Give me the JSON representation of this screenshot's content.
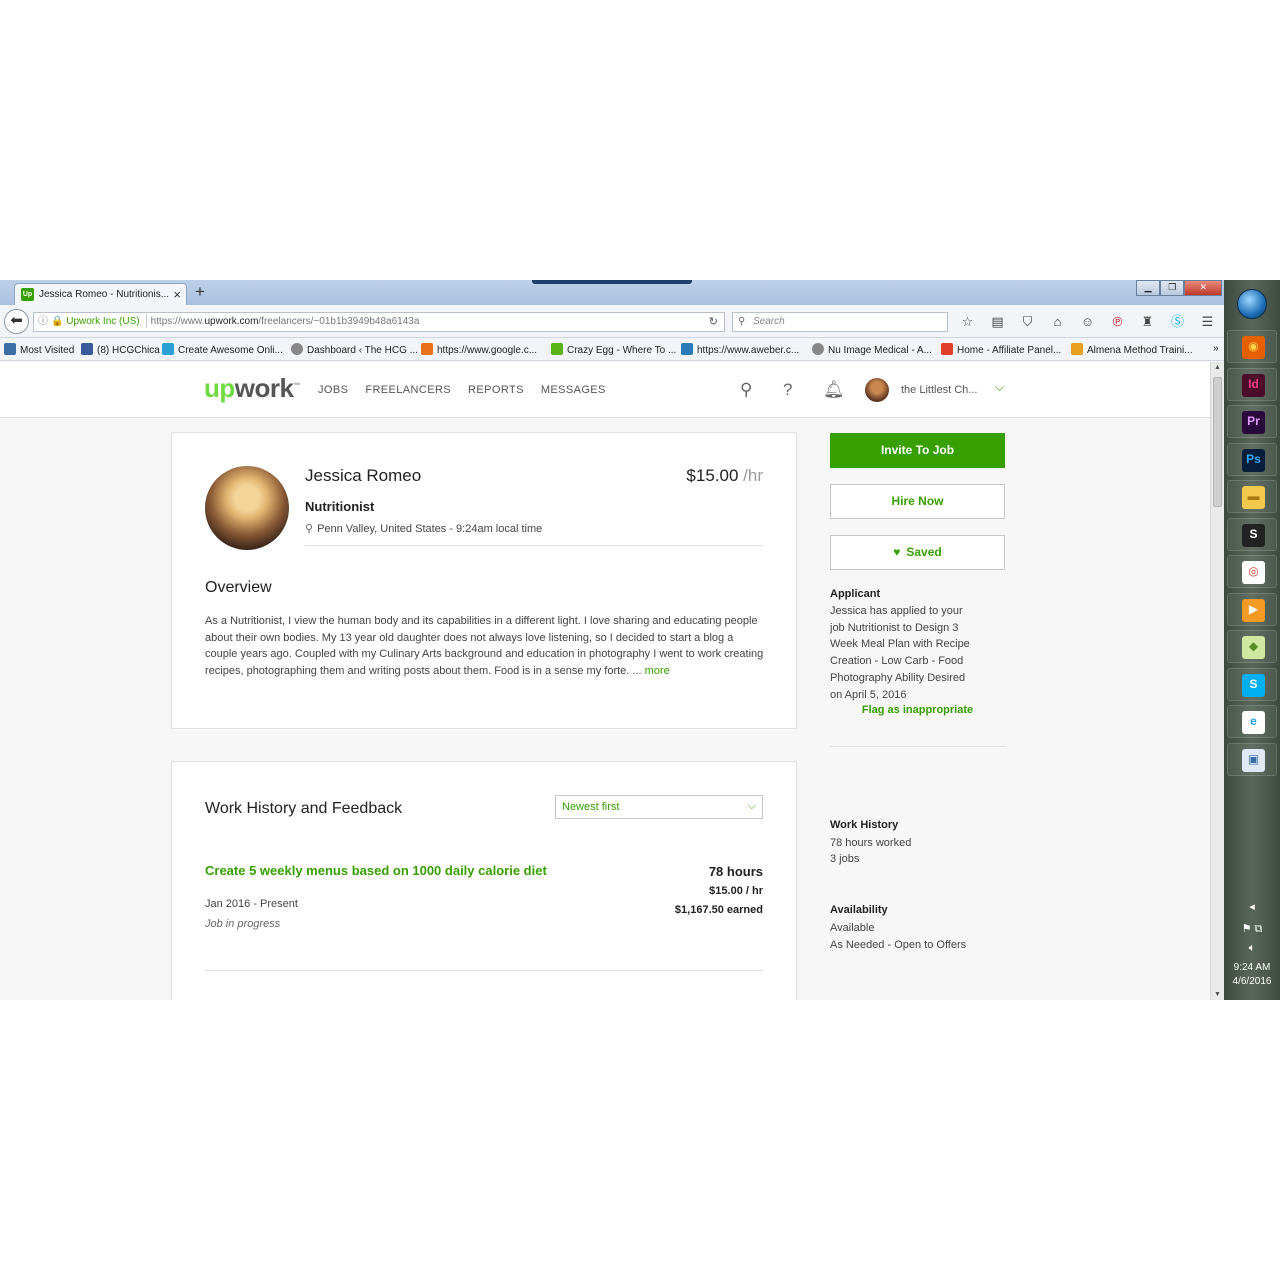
{
  "browser": {
    "tab_title": "Jessica Romeo - Nutritionis...",
    "url_org": "Upwork Inc (US)",
    "url_prefix": "https://www.",
    "url_domain": "upwork.com",
    "url_path": "/freelancers/~01b1b3949b48a6143a",
    "search_placeholder": "Search",
    "bookmarks": [
      {
        "label": "Most Visited",
        "color": "#3a6ea5"
      },
      {
        "label": "(8) HCGChica",
        "color": "#3b5998"
      },
      {
        "label": "Create Awesome Onli...",
        "color": "#2a9fd6"
      },
      {
        "label": "Dashboard ‹ The HCG ...",
        "color": "#666666"
      },
      {
        "label": "https://www.google.c...",
        "color": "#e8711a"
      },
      {
        "label": "Crazy Egg - Where To ...",
        "color": "#5bb318"
      },
      {
        "label": "https://www.aweber.c...",
        "color": "#2a7ab8"
      },
      {
        "label": "Nu Image Medical - A...",
        "color": "#666666"
      },
      {
        "label": "Home - Affiliate Panel...",
        "color": "#e0402a"
      },
      {
        "label": "Almena Method Traini...",
        "color": "#e8a020"
      }
    ]
  },
  "header": {
    "logo_up": "up",
    "logo_work": "work",
    "logo_tm": "™",
    "nav": [
      "JOBS",
      "FREELANCERS",
      "REPORTS",
      "MESSAGES"
    ],
    "username": "the Littlest Ch..."
  },
  "profile": {
    "name": "Jessica Romeo",
    "rate": "$15.00",
    "rate_unit": "/hr",
    "title": "Nutritionist",
    "location": "Penn Valley, United States - 9:24am local time",
    "overview_heading": "Overview",
    "overview_text": "As a Nutritionist, I view the human body and its capabilities in a different light. I love sharing and educating people about their own bodies. My 13 year old daughter does not always love listening, so I decided to start a blog a couple years ago. Coupled with my Culinary Arts background and education in photography I went to work creating recipes, photographing them and writing posts about them. Food is in a sense my forte. ...",
    "more_link": "more"
  },
  "work_history": {
    "heading": "Work History and Feedback",
    "sort_value": "Newest first",
    "jobs": [
      {
        "title": "Create 5 weekly menus based on 1000 daily calorie diet",
        "dates": "Jan 2016 - Present",
        "status": "Job in progress",
        "hours": "78 hours",
        "rate": "$15.00 / hr",
        "earned": "$1,167.50 earned"
      }
    ]
  },
  "sidebar": {
    "invite_button": "Invite To Job",
    "hire_button": "Hire Now",
    "saved_button": "Saved",
    "applicant_heading": "Applicant",
    "applicant_lines": [
      "Jessica has applied to your",
      "job Nutritionist to Design 3",
      "Week Meal Plan with Recipe",
      "Creation - Low Carb - Food",
      "Photography Ability Desired",
      "on April 5, 2016"
    ],
    "flag_link": "Flag as inappropriate",
    "work_history_heading": "Work History",
    "hours_worked": "78 hours worked",
    "jobs_count": "3 jobs",
    "availability_heading": "Availability",
    "availability_status": "Available",
    "availability_detail": "As Needed - Open to Offers"
  },
  "taskbar": {
    "time": "9:24 AM",
    "date": "4/6/2016",
    "apps": [
      {
        "name": "firefox",
        "glyph": "◉",
        "bg": "#e66000",
        "fg": "#ffd54a"
      },
      {
        "name": "indesign",
        "glyph": "Id",
        "bg": "#4a0e2b",
        "fg": "#ff3d88"
      },
      {
        "name": "premiere",
        "glyph": "Pr",
        "bg": "#2a0a3d",
        "fg": "#e19aff"
      },
      {
        "name": "photoshop",
        "glyph": "Ps",
        "bg": "#061e3a",
        "fg": "#31a8ff"
      },
      {
        "name": "folder",
        "glyph": "▬",
        "bg": "#f2c94c",
        "fg": "#a97a12"
      },
      {
        "name": "scrivener",
        "glyph": "S",
        "bg": "#222222",
        "fg": "#ffffff"
      },
      {
        "name": "chrome",
        "glyph": "◎",
        "bg": "#ffffff",
        "fg": "#db4437"
      },
      {
        "name": "media",
        "glyph": "▶",
        "bg": "#f59a23",
        "fg": "#ffffff"
      },
      {
        "name": "sticky",
        "glyph": "◆",
        "bg": "#cfe8a0",
        "fg": "#5a8a2a"
      },
      {
        "name": "skype",
        "glyph": "S",
        "bg": "#00aff0",
        "fg": "#ffffff"
      },
      {
        "name": "ie",
        "glyph": "e",
        "bg": "#ffffff",
        "fg": "#1ea0e8"
      },
      {
        "name": "paint",
        "glyph": "▣",
        "bg": "#dfe9f5",
        "fg": "#3a6ea5"
      }
    ]
  },
  "colors": {
    "accent": "#37a000",
    "logo_green": "#6fda44"
  }
}
